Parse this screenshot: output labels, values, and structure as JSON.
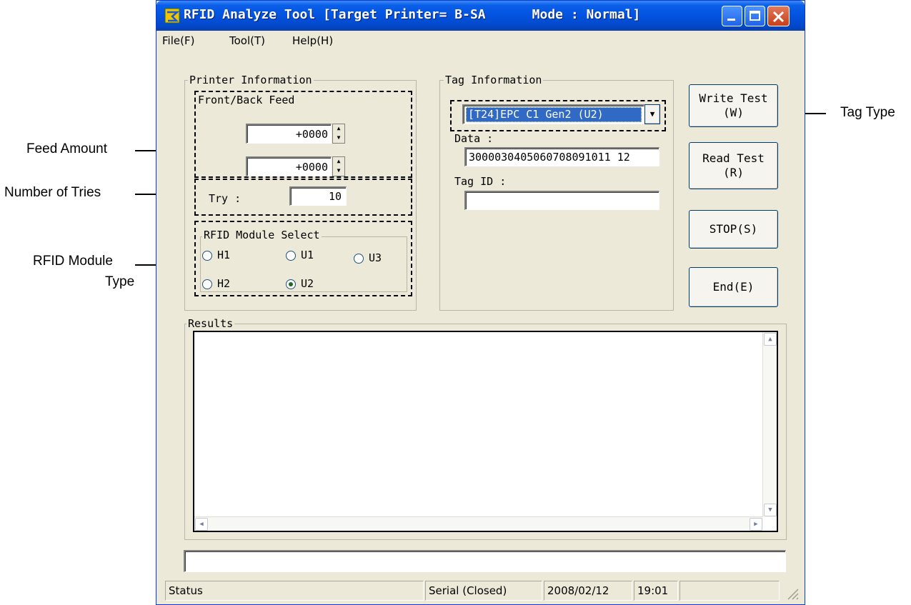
{
  "window": {
    "title": "RFID Analyze Tool [Target Printer= B-SA      Mode : Normal]"
  },
  "menu": {
    "file": "File(F)",
    "tool": "Tool(T)",
    "help": "Help(H)"
  },
  "printer_info": {
    "label": "Printer Information",
    "feed_group": "Front/Back Feed",
    "feed_front": "+0000",
    "feed_back": "+0000",
    "try_label": "Try :",
    "try_value": "10",
    "module_group": "RFID Module Select",
    "modules": [
      "H1",
      "U1",
      "U3",
      "H2",
      "U2"
    ],
    "selected_module": "U2"
  },
  "tag_info": {
    "label": "Tag Information",
    "tag_type": "[T24]EPC C1 Gen2 (U2)",
    "data_label": "Data :",
    "data_value": "3000030405060708091011 12",
    "tag_id_label": "Tag ID :",
    "tag_id_value": ""
  },
  "buttons": {
    "write_test": "Write Test",
    "write_key": "(W)",
    "read_test": "Read Test",
    "read_key": "(R)",
    "stop": "STOP(S)",
    "end": "End(E)"
  },
  "results": {
    "label": "Results",
    "content": ""
  },
  "message_bar": "",
  "statusbar": {
    "status": "Status",
    "port": "Serial (Closed)",
    "date": "2008/02/12",
    "time": "19:01",
    "extra": ""
  },
  "callouts": {
    "feed_amount": "Feed Amount",
    "number_of_tries": "Number of Tries",
    "rfid_module_type_1": "RFID Module",
    "rfid_module_type_2": "Type",
    "tag_type": "Tag Type"
  },
  "colors": {
    "titlebar": "#0353e0",
    "window_bg": "#ece9d8",
    "selection": "#316ac5"
  }
}
